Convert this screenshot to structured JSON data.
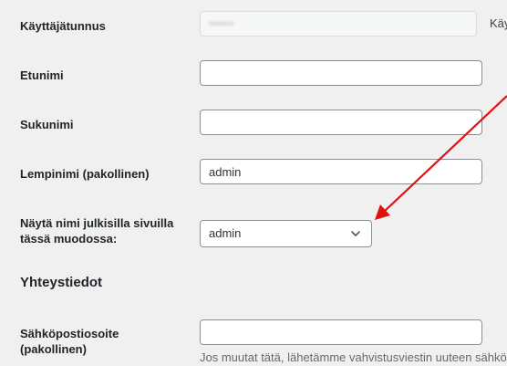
{
  "fields": {
    "username": {
      "label": "Käyttäjätunnus",
      "value": "••••••",
      "trailing_text": "Käy"
    },
    "first_name": {
      "label": "Etunimi",
      "value": ""
    },
    "last_name": {
      "label": "Sukunimi",
      "value": ""
    },
    "nickname": {
      "label": "Lempinimi (pakollinen)",
      "value": "admin"
    },
    "display_name": {
      "label_line1": "Näytä nimi julkisilla sivuilla",
      "label_line2": "tässä muodossa:",
      "selected": "admin"
    },
    "email": {
      "label_line1": "Sähköpostiosoite",
      "label_line2": "(pakollinen)",
      "value": "",
      "description": "Jos muutat tätä, lähetämme vahvistusviestin uuteen sähkö"
    }
  },
  "sections": {
    "contact_title": "Yhteystiedot"
  },
  "annotation": {
    "arrow_color": "#e01010"
  },
  "colors": {
    "background": "#f0f0f1",
    "field_border": "#8c8f94",
    "text": "#1d2327"
  }
}
